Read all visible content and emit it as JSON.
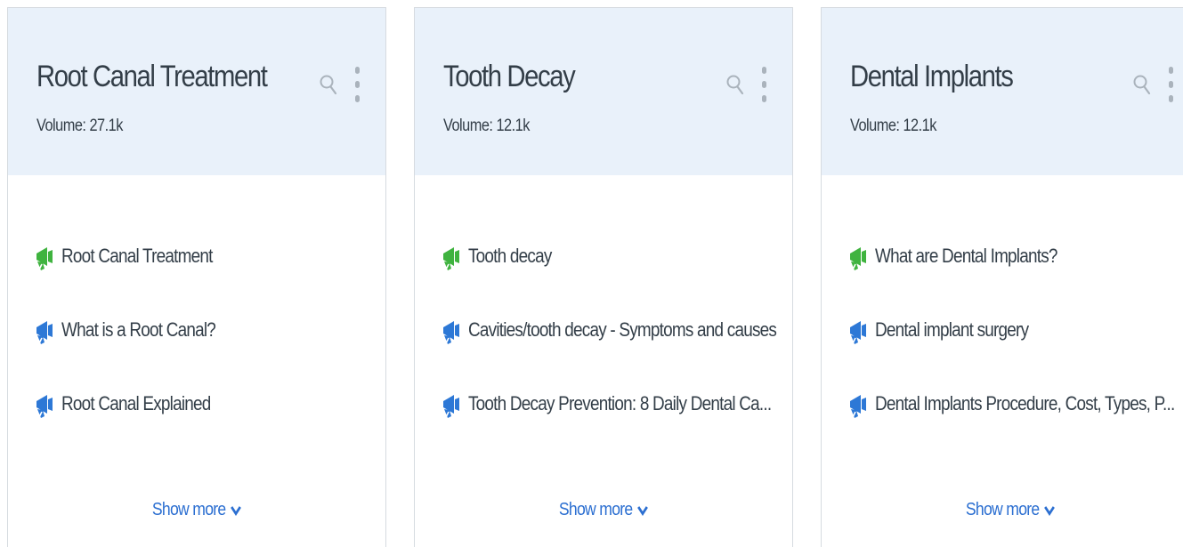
{
  "colors": {
    "header_bg": "#e9f1fa",
    "text": "#333e48",
    "link": "#2c6fd1",
    "icon_green": "#3fb33f",
    "icon_blue": "#2d78d6",
    "icon_gray": "#aab3bc"
  },
  "cards": [
    {
      "title": "Root Canal Treatment",
      "volume": "Volume: 27.1k",
      "results": [
        {
          "text": "Root Canal Treatment",
          "icon": "green-rank-icon"
        },
        {
          "text": "What is a Root Canal?",
          "icon": "blue-rank-icon"
        },
        {
          "text": "Root Canal Explained",
          "icon": "blue-rank-icon"
        }
      ],
      "show_more": "Show more"
    },
    {
      "title": "Tooth Decay",
      "volume": "Volume: 12.1k",
      "results": [
        {
          "text": "Tooth decay",
          "icon": "green-rank-icon"
        },
        {
          "text": "Cavities/tooth decay - Symptoms and causes",
          "icon": "blue-rank-icon"
        },
        {
          "text": "Tooth Decay Prevention: 8 Daily Dental Ca...",
          "icon": "blue-rank-icon"
        }
      ],
      "show_more": "Show more"
    },
    {
      "title": "Dental Implants",
      "volume": "Volume: 12.1k",
      "results": [
        {
          "text": "What are Dental Implants?",
          "icon": "green-rank-icon"
        },
        {
          "text": "Dental implant surgery",
          "icon": "blue-rank-icon"
        },
        {
          "text": "Dental Implants Procedure, Cost, Types, P...",
          "icon": "blue-rank-icon"
        }
      ],
      "show_more": "Show more"
    }
  ]
}
